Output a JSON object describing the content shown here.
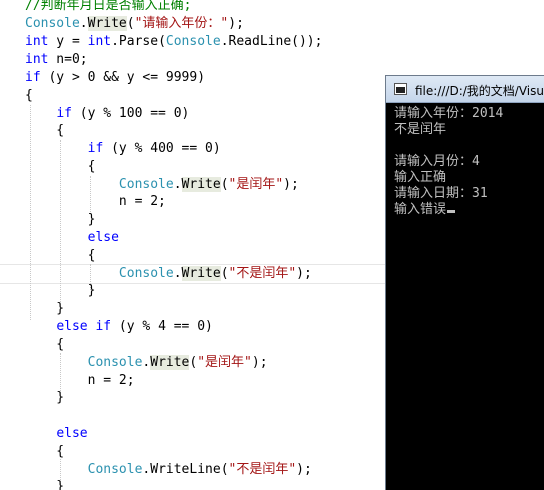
{
  "editor": {
    "lines": [
      {
        "segments": [
          {
            "text": "//判断年月日是否输入正确;",
            "c": "cm"
          }
        ]
      },
      {
        "segments": [
          {
            "text": "Console",
            "c": "ty"
          },
          {
            "text": "."
          },
          {
            "text": "Write",
            "c": "hl"
          },
          {
            "text": "("
          },
          {
            "text": "\"请输入年份：\"",
            "c": "st"
          },
          {
            "text": ");"
          }
        ]
      },
      {
        "segments": [
          {
            "text": "int",
            "c": "kw"
          },
          {
            "text": " y = "
          },
          {
            "text": "int",
            "c": "kw"
          },
          {
            "text": ".Parse("
          },
          {
            "text": "Console",
            "c": "ty"
          },
          {
            "text": ".ReadLine());"
          }
        ]
      },
      {
        "segments": [
          {
            "text": "int",
            "c": "kw"
          },
          {
            "text": " n=0;"
          }
        ]
      },
      {
        "segments": [
          {
            "text": "if",
            "c": "kw"
          },
          {
            "text": " (y > 0 && y <= 9999)"
          }
        ]
      },
      {
        "segments": [
          {
            "text": "{"
          }
        ]
      },
      {
        "segments": [
          {
            "text": "    "
          },
          {
            "text": "if",
            "c": "kw"
          },
          {
            "text": " (y % 100 == 0)"
          }
        ]
      },
      {
        "segments": [
          {
            "text": "    {"
          }
        ]
      },
      {
        "segments": [
          {
            "text": "        "
          },
          {
            "text": "if",
            "c": "kw"
          },
          {
            "text": " (y % 400 == 0)"
          }
        ]
      },
      {
        "segments": [
          {
            "text": "        {"
          }
        ]
      },
      {
        "segments": [
          {
            "text": "            "
          },
          {
            "text": "Console",
            "c": "ty"
          },
          {
            "text": "."
          },
          {
            "text": "Write",
            "c": "hl"
          },
          {
            "text": "("
          },
          {
            "text": "\"是闰年\"",
            "c": "st"
          },
          {
            "text": ");"
          }
        ]
      },
      {
        "segments": [
          {
            "text": "            n = 2;"
          }
        ]
      },
      {
        "segments": [
          {
            "text": "        }"
          }
        ]
      },
      {
        "segments": [
          {
            "text": "        "
          },
          {
            "text": "else",
            "c": "kw"
          }
        ]
      },
      {
        "segments": [
          {
            "text": "        {"
          }
        ]
      },
      {
        "segments": [
          {
            "text": "            "
          },
          {
            "text": "Console",
            "c": "ty"
          },
          {
            "text": "."
          },
          {
            "text": "Write",
            "c": "hl"
          },
          {
            "text": "("
          },
          {
            "text": "\"不是闰年\"",
            "c": "st"
          },
          {
            "text": ");"
          }
        ]
      },
      {
        "segments": [
          {
            "text": "        }"
          }
        ]
      },
      {
        "segments": [
          {
            "text": "    }"
          }
        ]
      },
      {
        "segments": [
          {
            "text": "    "
          },
          {
            "text": "else",
            "c": "kw"
          },
          {
            "text": " "
          },
          {
            "text": "if",
            "c": "kw"
          },
          {
            "text": " (y % 4 == 0)"
          }
        ]
      },
      {
        "segments": [
          {
            "text": "    {"
          }
        ]
      },
      {
        "segments": [
          {
            "text": "        "
          },
          {
            "text": "Console",
            "c": "ty"
          },
          {
            "text": "."
          },
          {
            "text": "Write",
            "c": "hl"
          },
          {
            "text": "("
          },
          {
            "text": "\"是闰年\"",
            "c": "st"
          },
          {
            "text": ");"
          }
        ]
      },
      {
        "segments": [
          {
            "text": "        n = 2;"
          }
        ]
      },
      {
        "segments": [
          {
            "text": "    }"
          }
        ]
      },
      {
        "segments": [
          {
            "text": ""
          }
        ]
      },
      {
        "segments": [
          {
            "text": "    "
          },
          {
            "text": "else",
            "c": "kw"
          }
        ]
      },
      {
        "segments": [
          {
            "text": "    {"
          }
        ]
      },
      {
        "segments": [
          {
            "text": "        "
          },
          {
            "text": "Console",
            "c": "ty"
          },
          {
            "text": ".WriteLine("
          },
          {
            "text": "\"不是闰年\"",
            "c": "st"
          },
          {
            "text": ");"
          }
        ]
      },
      {
        "segments": [
          {
            "text": "    }"
          }
        ]
      }
    ]
  },
  "console": {
    "title": "file:///D:/我的文档/Visu",
    "lines": [
      "请输入年份：2014",
      "不是闰年",
      "",
      "请输入月份：4",
      "输入正确",
      "请输入日期：31",
      "输入错误"
    ]
  },
  "colors": {
    "keyword": "#0000ff",
    "type": "#2b91af",
    "string": "#a31515",
    "comment": "#008000",
    "highlight": "#e7ebdf",
    "console_bg": "#000000",
    "console_text": "#c0c0c0"
  }
}
